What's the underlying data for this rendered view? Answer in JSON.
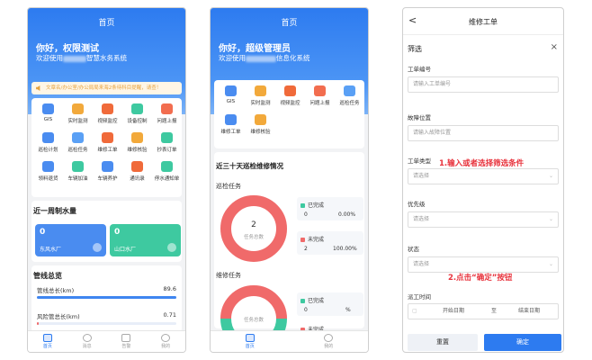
{
  "colors": {
    "primary": "#2d7bf0",
    "green": "#3ec9a0",
    "red": "#f06a6a",
    "annotation": "#e8323c"
  },
  "screen1": {
    "title": "首页",
    "greeting": "你好，权限测试",
    "subtitle_prefix": "欢迎使用",
    "subtitle_suffix": "智慧水务系统",
    "notice": "文章名/办公室/办公局局来海2条待科目提醒，请查！",
    "grid": [
      {
        "label": "GIS",
        "icon": "gis-icon",
        "color": "#4a8cf0"
      },
      {
        "label": "实时监测",
        "icon": "monitor-icon",
        "color": "#f2a93b"
      },
      {
        "label": "视频监控",
        "icon": "camera-icon",
        "color": "#f06a3a"
      },
      {
        "label": "设备控制",
        "icon": "device-control-icon",
        "color": "#3ec9a0"
      },
      {
        "label": "问题上报",
        "icon": "report-icon",
        "color": "#f26d4f"
      },
      {
        "label": "巡检计划",
        "icon": "patrol-plan-icon",
        "color": "#4a8cf0"
      },
      {
        "label": "巡检任务",
        "icon": "patrol-task-icon",
        "color": "#5aa0f5"
      },
      {
        "label": "维修工单",
        "icon": "repair-order-icon",
        "color": "#f06a3a"
      },
      {
        "label": "维修核验",
        "icon": "repair-check-icon",
        "color": "#f2a93b"
      },
      {
        "label": "抄表订单",
        "icon": "meter-order-icon",
        "color": "#3ec9a0"
      },
      {
        "label": "领料退货",
        "icon": "material-icon",
        "color": "#4a8cf0"
      },
      {
        "label": "车辆加油",
        "icon": "fuel-icon",
        "color": "#3ec9a0"
      },
      {
        "label": "车辆养护",
        "icon": "vehicle-icon",
        "color": "#4a8cf0"
      },
      {
        "label": "通讯录",
        "icon": "contacts-icon",
        "color": "#f06a3a"
      },
      {
        "label": "停水通知单",
        "icon": "notice-icon",
        "color": "#3ec9a0"
      }
    ],
    "water_title": "近一周制水量",
    "tiles": [
      {
        "value": "0",
        "name": "东风水厂",
        "color": "#4a8cf0"
      },
      {
        "value": "0",
        "name": "山口水厂",
        "color": "#3ec9a0"
      }
    ],
    "pipe_title": "管线总览",
    "pipe_rows": [
      {
        "label": "管线总长(km)",
        "value": "89.6",
        "fill": 1.0
      },
      {
        "label": "风险管总长(km)",
        "value": "0.71",
        "fill": 0.008
      }
    ],
    "tabs": [
      "首页",
      "消息",
      "告警",
      "我的"
    ]
  },
  "screen2": {
    "title": "首页",
    "greeting": "你好，超级管理员",
    "subtitle_prefix": "欢迎使用",
    "subtitle_suffix": "信息化系统",
    "grid": [
      {
        "label": "GIS",
        "icon": "gis-icon",
        "color": "#4a8cf0"
      },
      {
        "label": "实时监测",
        "icon": "monitor-icon",
        "color": "#f2a93b"
      },
      {
        "label": "视频监控",
        "icon": "camera-icon",
        "color": "#f06a3a"
      },
      {
        "label": "问题上报",
        "icon": "report-icon",
        "color": "#f26d4f"
      },
      {
        "label": "巡检任务",
        "icon": "patrol-task-icon",
        "color": "#5aa0f5"
      },
      {
        "label": "维修工单",
        "icon": "repair-order-icon",
        "color": "#4a8cf0"
      },
      {
        "label": "维修核验",
        "icon": "repair-check-icon",
        "color": "#f2a93b"
      }
    ],
    "section_title": "近三十天巡检维修情况",
    "patrol": {
      "title": "巡检任务",
      "total": "2",
      "total_label": "任务总数",
      "done_label": "已完成",
      "done_count": "0",
      "done_pct": "0.00%",
      "todo_label": "未完成",
      "todo_count": "2",
      "todo_pct": "100.00%",
      "done_fraction": 0.0
    },
    "repair": {
      "title": "维修任务",
      "total_label": "任务总数",
      "done_label": "已完成",
      "done_count": "0",
      "done_pct": "%",
      "todo_label": "未完成"
    },
    "tabs": [
      "首页",
      "我的"
    ]
  },
  "screen3": {
    "back": "<",
    "title": "维修工单",
    "filter_title": "筛选",
    "close": "×",
    "fields": [
      {
        "label": "工单编号",
        "placeholder": "请输入工单编号",
        "type": "input"
      },
      {
        "label": "故障位置",
        "placeholder": "请输入故障位置",
        "type": "input"
      },
      {
        "label": "工单类型",
        "placeholder": "请选择",
        "type": "select"
      },
      {
        "label": "优先级",
        "placeholder": "请选择",
        "type": "select"
      },
      {
        "label": "状态",
        "placeholder": "请选择",
        "type": "select"
      }
    ],
    "time_label": "派工时间",
    "start_date": "开始日期",
    "to": "至",
    "end_date": "结束日期",
    "reset": "重置",
    "confirm": "确定",
    "annotation1": "1.输入或者选择筛选条件",
    "annotation2": "2.点击“确定”按钮"
  }
}
